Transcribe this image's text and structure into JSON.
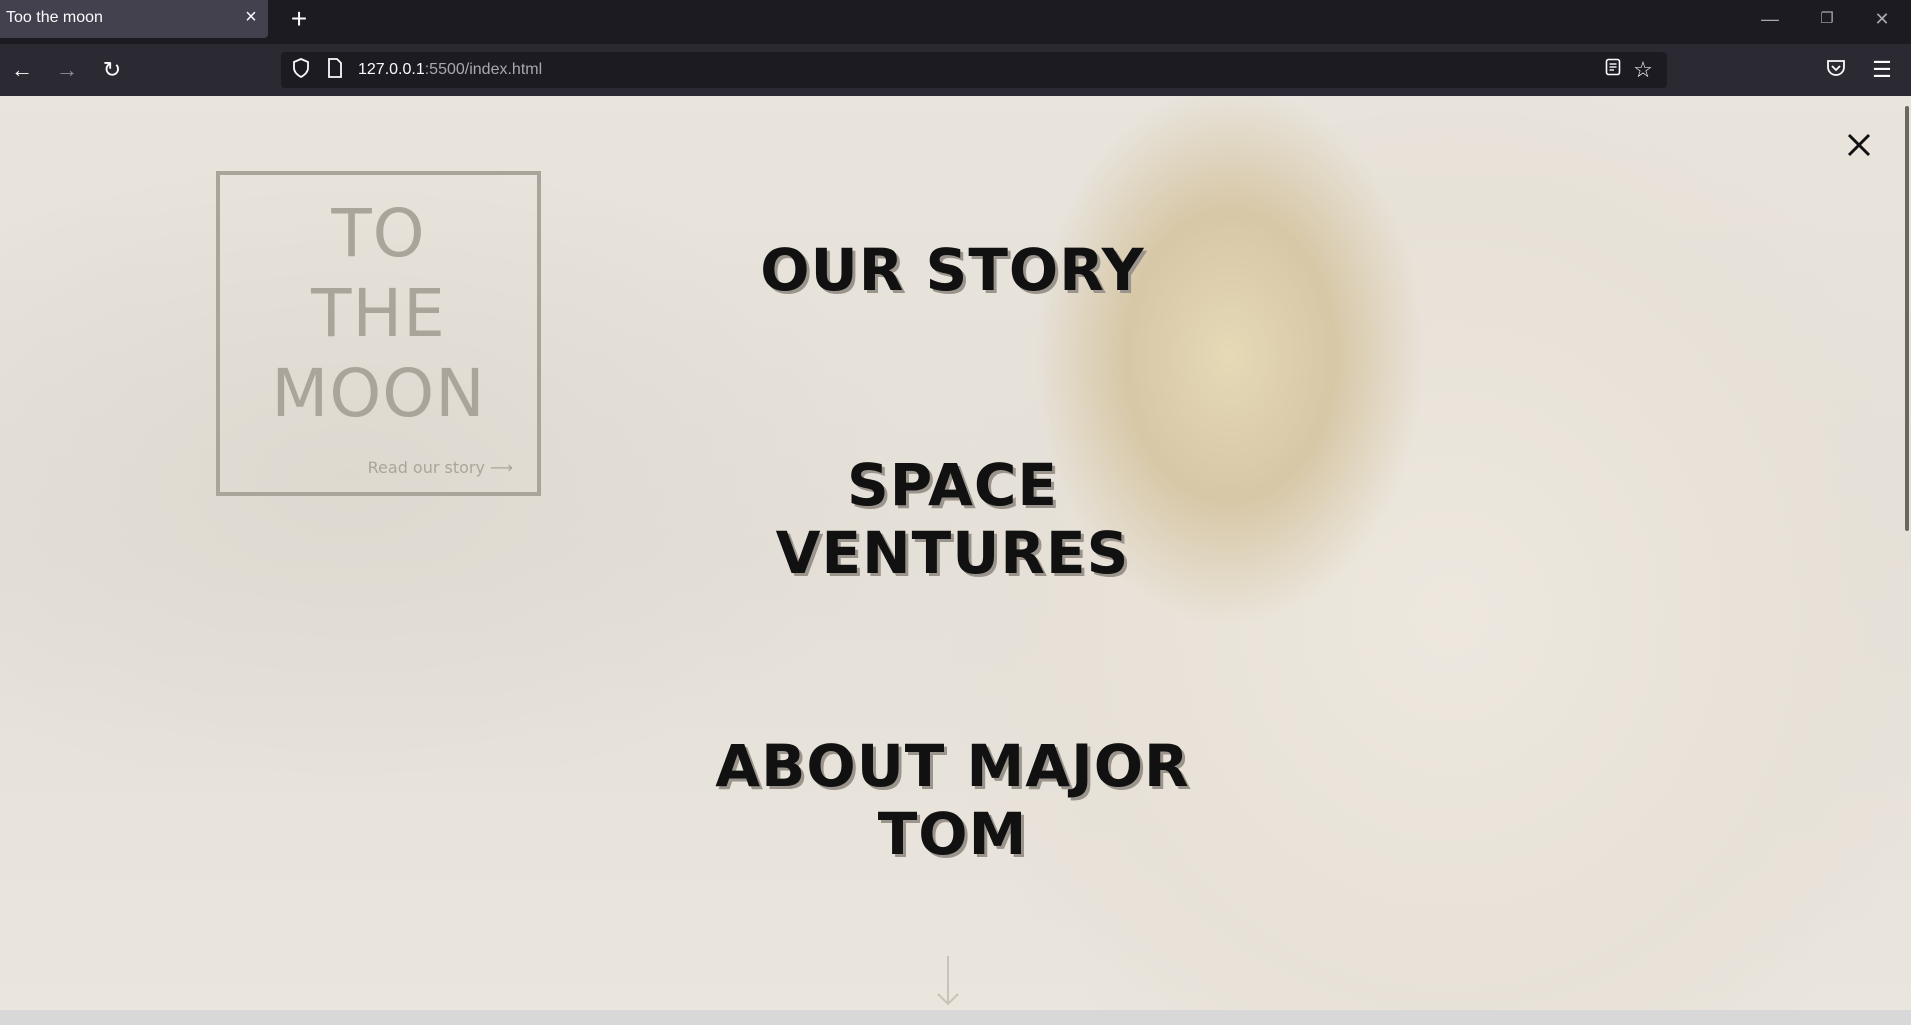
{
  "browser": {
    "tab_title": "Too the moon",
    "tab_close_icon": "close-icon",
    "new_tab_icon": "plus-icon",
    "url_host": "127.0.0.1",
    "url_path": ":5500/index.html"
  },
  "page": {
    "logo": {
      "line1": "TO",
      "line2": "THE",
      "line3": "MOON",
      "read_link": "Read our story ⟶"
    },
    "menu": {
      "item1": "OUR STORY",
      "item2": "SPACE VENTURES",
      "item3": "ABOUT MAJOR TOM"
    }
  },
  "colors": {
    "chrome_dark": "#1c1b22",
    "nav_bar": "#2b2a33",
    "menu_text": "#111111",
    "logo_faded": "#aba49a"
  }
}
